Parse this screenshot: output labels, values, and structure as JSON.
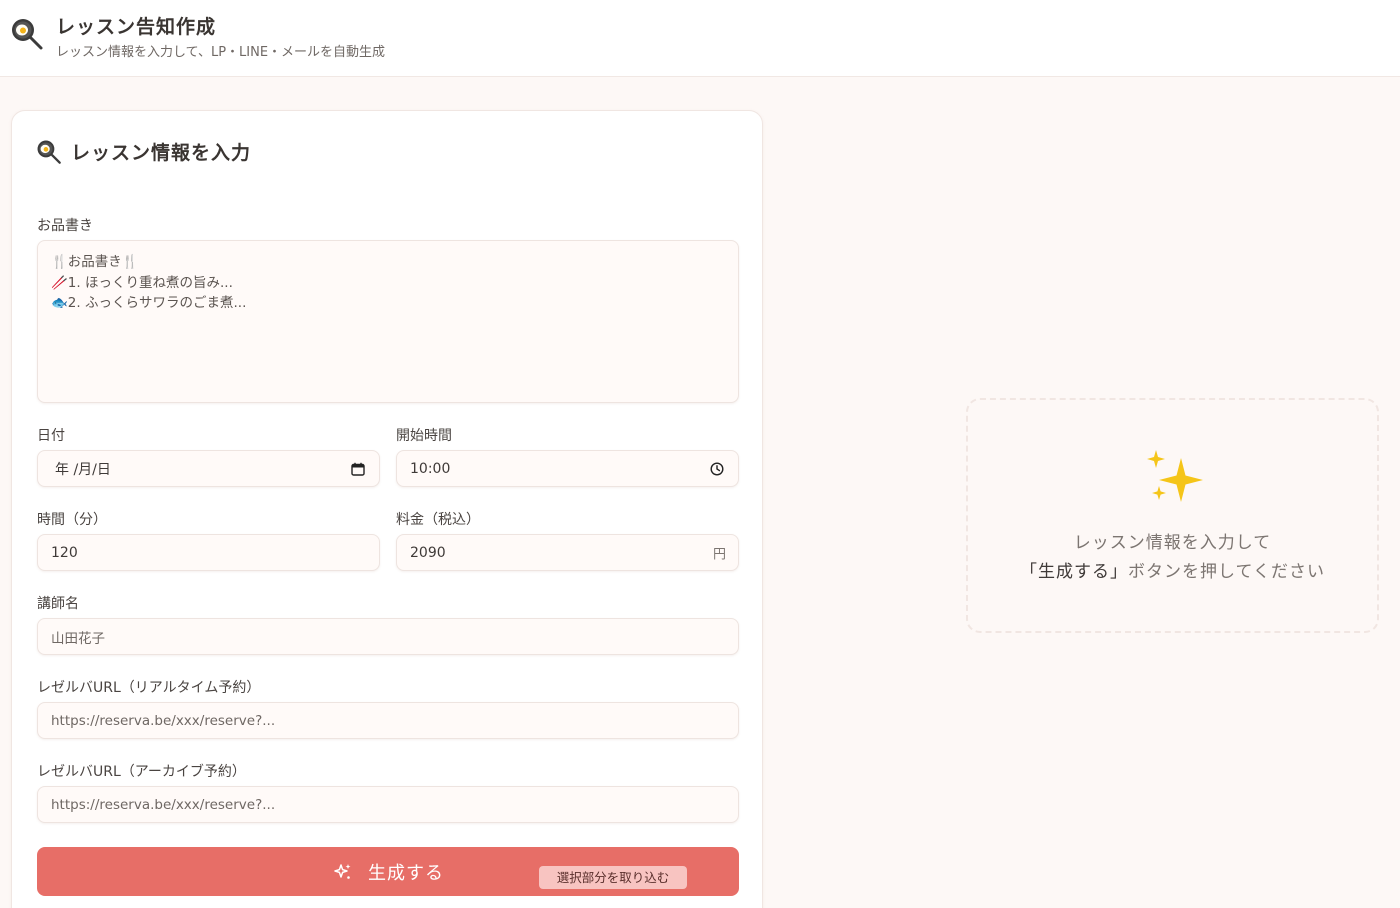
{
  "header": {
    "icon": "frying-pan-icon",
    "title": "レッスン告知作成",
    "subtitle": "レッスン情報を入力して、LP・LINE・メールを自動生成"
  },
  "form": {
    "icon": "frying-pan-icon",
    "heading": "レッスン情報を入力",
    "menu": {
      "label": "お品書き",
      "lines": [
        "🍴お品書き🍴",
        "🥢1. ほっくり重ね煮の旨み...",
        "🐟2. ふっくらサワラのごま煮..."
      ]
    },
    "date": {
      "label": "日付",
      "value": "年 /月/日",
      "icon": "calendar-icon"
    },
    "start_time": {
      "label": "開始時間",
      "value": "10:00",
      "icon": "clock-icon"
    },
    "duration": {
      "label": "時間（分）",
      "value": "120"
    },
    "price": {
      "label": "料金（税込）",
      "value": "2090",
      "unit": "円"
    },
    "instructor": {
      "label": "講師名",
      "placeholder": "山田花子"
    },
    "url_realtime": {
      "label": "レゼルバURL（リアルタイム予約）",
      "placeholder": "https://reserva.be/xxx/reserve?..."
    },
    "url_archive": {
      "label": "レゼルバURL（アーカイブ予約）",
      "placeholder": "https://reserva.be/xxx/reserve?..."
    },
    "submit": {
      "label": "生成する",
      "icon": "sparkle-icon"
    },
    "capture_badge": "選択部分を取り込む"
  },
  "preview": {
    "icon": "sparkles-icon",
    "line1": "レッスン情報を入力して",
    "line2_strong": "「生成する」",
    "line2_rest": "ボタンを押してください"
  },
  "colors": {
    "accent": "#e76e67",
    "background": "#fdf8f6",
    "sparkle": "#f5c518"
  }
}
